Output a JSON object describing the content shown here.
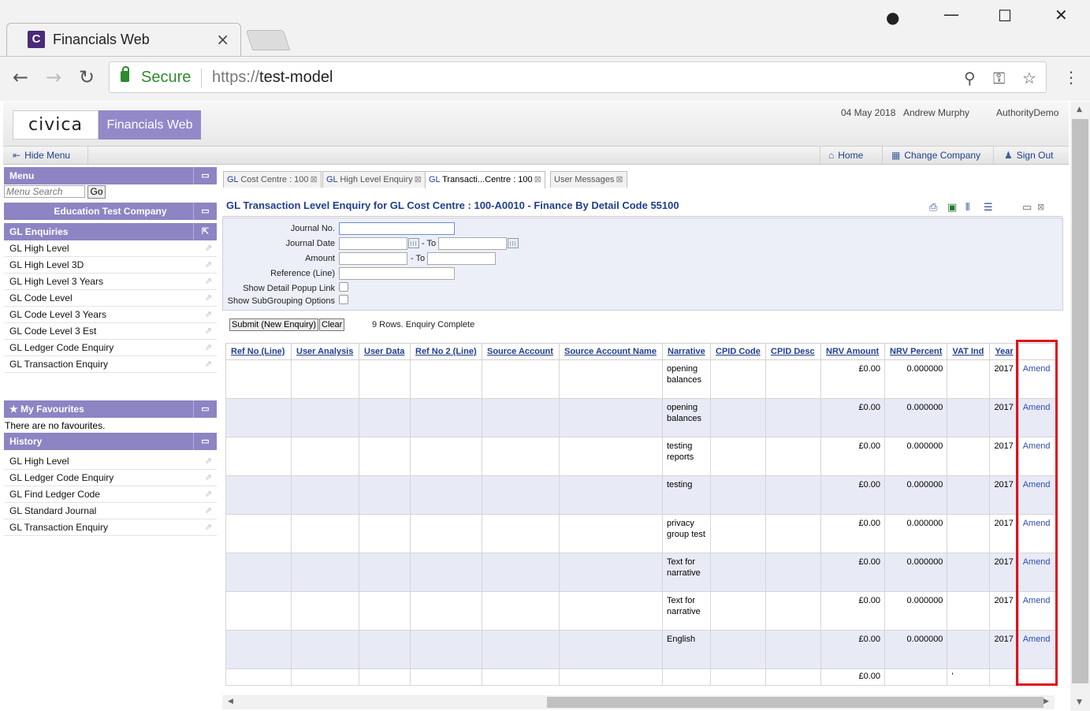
{
  "browser": {
    "tab_title": "Financials Web",
    "tab_favicon": "C",
    "secure_label": "Secure",
    "url_scheme": "https://",
    "url_host": "test-model"
  },
  "header": {
    "logo_text": "civica",
    "product_name": "Financials Web",
    "date": "04 May 2018",
    "user": "Andrew Murphy",
    "company": "AuthorityDemo"
  },
  "nav": {
    "hide_menu": "Hide Menu",
    "home": "Home",
    "change_company": "Change Company",
    "sign_out": "Sign Out"
  },
  "sidebar": {
    "menu_title": "Menu",
    "search_placeholder": "Menu Search",
    "go_label": "Go",
    "company_title": "Education Test Company",
    "gl_enquiries_title": "GL Enquiries",
    "gl_enquiries": [
      "GL High Level",
      "GL High Level 3D",
      "GL High Level 3 Years",
      "GL Code Level",
      "GL Code Level 3 Years",
      "GL Code Level 3 Est",
      "GL Ledger Code Enquiry",
      "GL Transaction Enquiry"
    ],
    "favourites_title": "My Favourites",
    "favourites_empty": "There are no favourites.",
    "history_title": "History",
    "history": [
      "GL High Level",
      "GL Ledger Code Enquiry",
      "GL Find Ledger Code",
      "GL Standard Journal",
      "GL Transaction Enquiry"
    ]
  },
  "content_tabs": [
    {
      "prefix": "GL",
      "label": " Cost Centre : 100"
    },
    {
      "prefix": "GL",
      "label": " High Level Enquiry"
    },
    {
      "prefix": "GL",
      "label": " Transacti...Centre : 100"
    },
    {
      "prefix": "",
      "label": "User Messages"
    }
  ],
  "enquiry": {
    "title": "GL Transaction Level Enquiry for GL Cost Centre : 100-A0010 - Finance By Detail Code 55100",
    "labels": {
      "journal_no": "Journal No.",
      "journal_date": "Journal Date",
      "amount": "Amount",
      "reference": "Reference (Line)",
      "show_detail": "Show Detail Popup Link",
      "show_subgrouping": "Show SubGrouping Options",
      "to": "- To"
    },
    "submit_label": "Submit (New Enquiry)",
    "clear_label": "Clear",
    "status_text": "9 Rows. Enquiry Complete"
  },
  "table": {
    "columns": [
      "Ref No (Line)",
      "User Analysis",
      "User Data",
      "Ref No 2 (Line)",
      "Source Account",
      "Source Account Name",
      "Narrative",
      "CPID Code",
      "CPID Desc",
      "NRV Amount",
      "NRV Percent",
      "VAT Ind",
      "Year",
      ""
    ],
    "rows": [
      {
        "narrative": "opening balances",
        "amount": "£0.00",
        "percent": "0.000000",
        "year": "2017",
        "action": "Amend"
      },
      {
        "narrative": "opening balances",
        "amount": "£0.00",
        "percent": "0.000000",
        "year": "2017",
        "action": "Amend"
      },
      {
        "narrative": "testing reports",
        "amount": "£0.00",
        "percent": "0.000000",
        "year": "2017",
        "action": "Amend"
      },
      {
        "narrative": "testing",
        "amount": "£0.00",
        "percent": "0.000000",
        "year": "2017",
        "action": "Amend"
      },
      {
        "narrative": "privacy group test",
        "amount": "£0.00",
        "percent": "0.000000",
        "year": "2017",
        "action": "Amend"
      },
      {
        "narrative": "Text for narrative",
        "amount": "£0.00",
        "percent": "0.000000",
        "year": "2017",
        "action": "Amend"
      },
      {
        "narrative": "Text for narrative",
        "amount": "£0.00",
        "percent": "0.000000",
        "year": "2017",
        "action": "Amend"
      },
      {
        "narrative": "English",
        "amount": "£0.00",
        "percent": "0.000000",
        "year": "2017",
        "action": "Amend"
      }
    ],
    "total": {
      "amount": "£0.00",
      "vat": "'"
    }
  },
  "colors": {
    "panel_header": "#8d84c4",
    "link_blue": "#1f3f8f",
    "highlight_red": "#e0101a",
    "alt_row": "#e8eaf6"
  }
}
